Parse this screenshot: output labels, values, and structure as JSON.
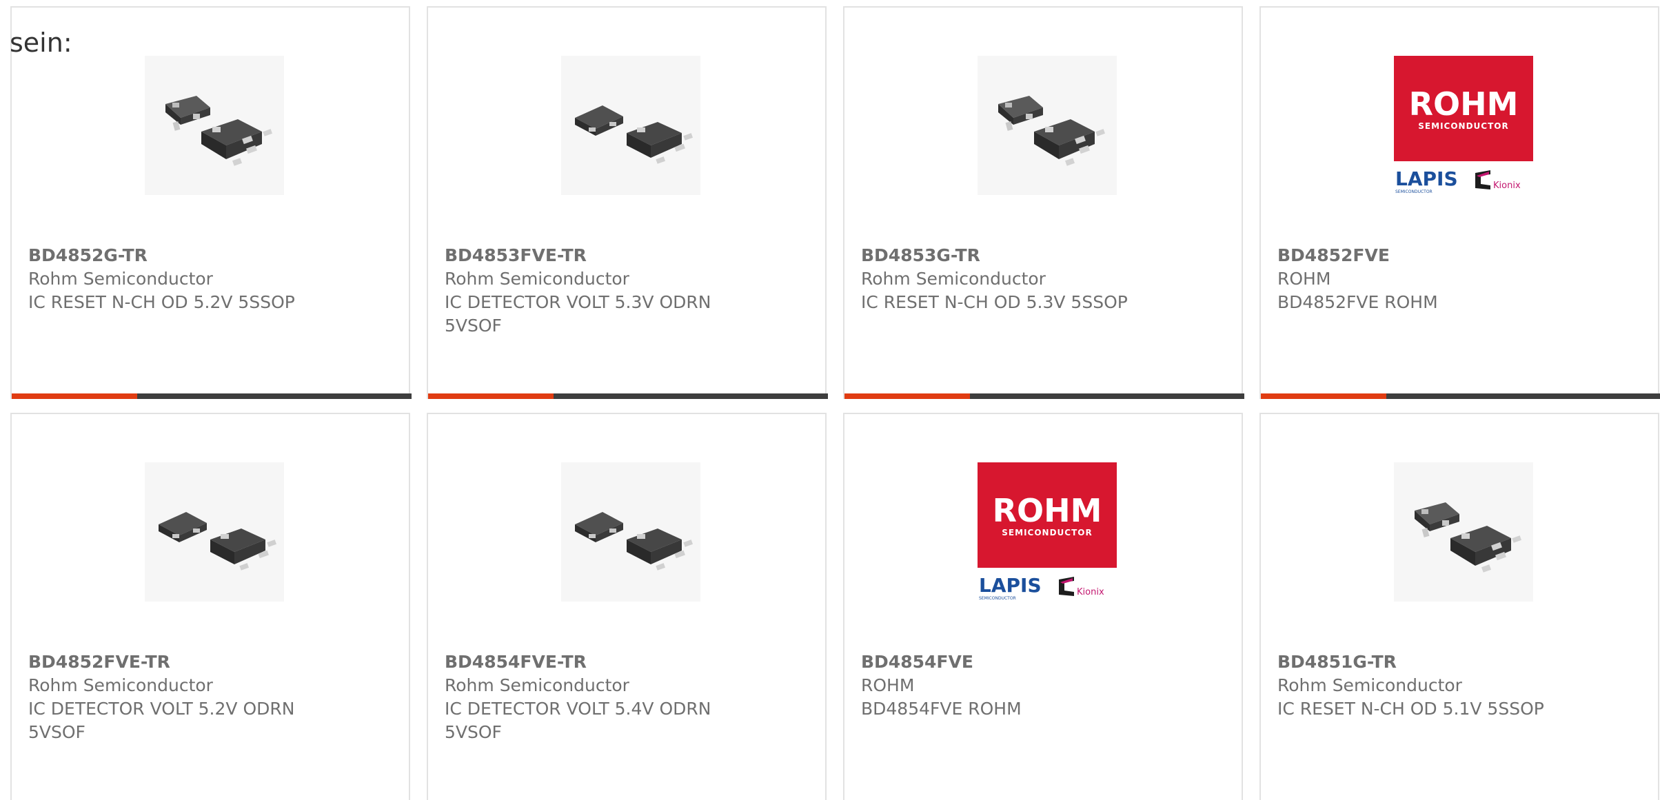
{
  "intro_text": "sein:",
  "colors": {
    "accent": "#e03c12",
    "bar": "#3e3e3e",
    "rohm_red": "#d7172f",
    "lapis_blue": "#1b4f9c",
    "kionix_magenta": "#c3166f"
  },
  "cards": [
    {
      "part_number": "BD4852G-TR",
      "manufacturer": "Rohm Semiconductor",
      "description": "IC RESET N-CH OD 5.2V 5SSOP",
      "image": "sot-package-photo"
    },
    {
      "part_number": "BD4853FVE-TR",
      "manufacturer": "Rohm Semiconductor",
      "description": "IC DETECTOR VOLT 5.3V ODRN 5VSOF",
      "image": "vsof-package-photo"
    },
    {
      "part_number": "BD4853G-TR",
      "manufacturer": "Rohm Semiconductor",
      "description": "IC RESET N-CH OD 5.3V 5SSOP",
      "image": "sot-package-photo"
    },
    {
      "part_number": "BD4852FVE",
      "manufacturer": "ROHM",
      "description": "BD4852FVE ROHM",
      "image": "rohm-logo",
      "logo": {
        "brand": "ROHM",
        "sub": "SEMICONDUCTOR",
        "lapis": "LAPIS",
        "lapis_sub": "SEMICONDUCTOR",
        "kionix": "Kionix"
      }
    },
    {
      "part_number": "BD4852FVE-TR",
      "manufacturer": "Rohm Semiconductor",
      "description": "IC DETECTOR VOLT 5.2V ODRN 5VSOF",
      "image": "vsof-package-photo"
    },
    {
      "part_number": "BD4854FVE-TR",
      "manufacturer": "Rohm Semiconductor",
      "description": "IC DETECTOR VOLT 5.4V ODRN 5VSOF",
      "image": "vsof-package-photo"
    },
    {
      "part_number": "BD4854FVE",
      "manufacturer": "ROHM",
      "description": "BD4854FVE ROHM",
      "image": "rohm-logo",
      "logo": {
        "brand": "ROHM",
        "sub": "SEMICONDUCTOR",
        "lapis": "LAPIS",
        "lapis_sub": "SEMICONDUCTOR",
        "kionix": "Kionix"
      }
    },
    {
      "part_number": "BD4851G-TR",
      "manufacturer": "Rohm Semiconductor",
      "description": "IC RESET N-CH OD 5.1V 5SSOP",
      "image": "sot-package-photo"
    }
  ]
}
